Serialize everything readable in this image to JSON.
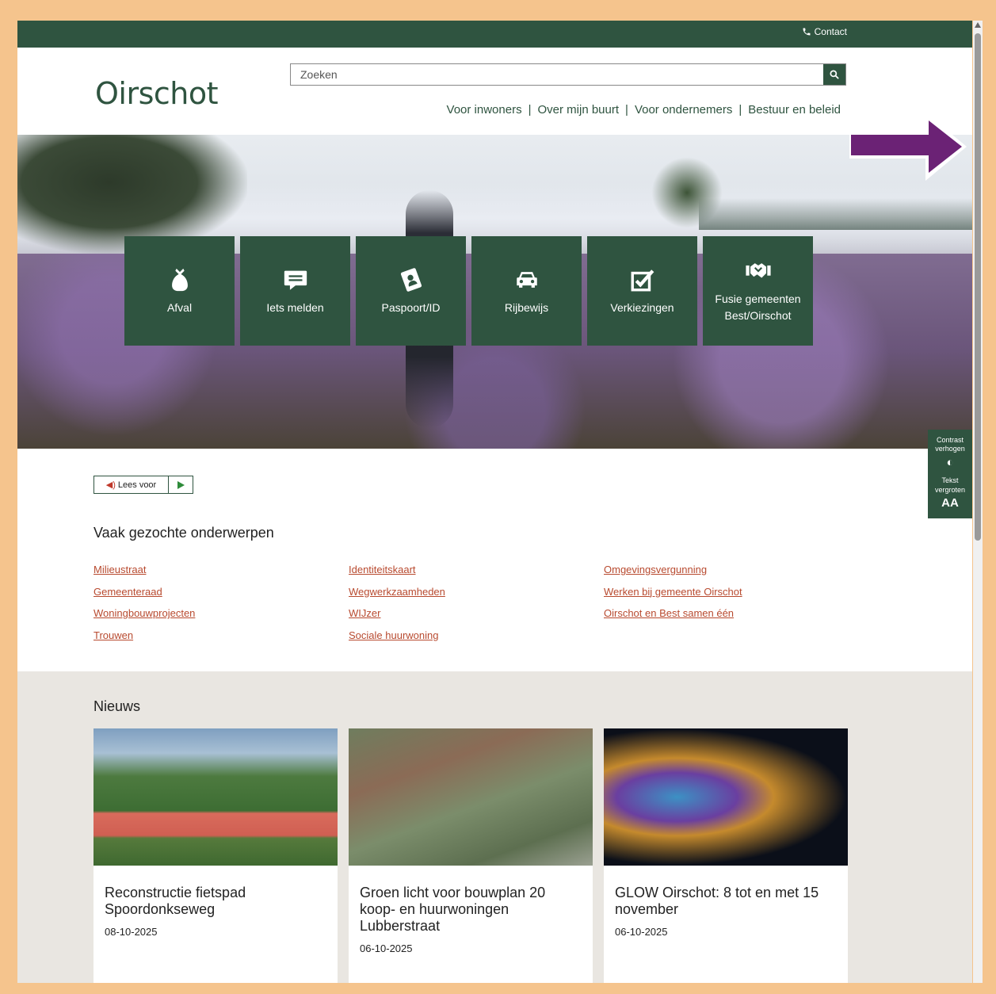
{
  "topbar": {
    "contact_label": "Contact"
  },
  "header": {
    "logo_text": "Oirschot",
    "search_placeholder": "Zoeken",
    "nav": [
      "Voor inwoners",
      "Over mijn buurt",
      "Voor ondernemers",
      "Bestuur en beleid"
    ]
  },
  "tiles": [
    {
      "label": "Afval",
      "icon": "trash-bag-icon"
    },
    {
      "label": "Iets melden",
      "icon": "chat-bubble-icon"
    },
    {
      "label": "Paspoort/ID",
      "icon": "id-card-icon"
    },
    {
      "label": "Rijbewijs",
      "icon": "car-icon"
    },
    {
      "label": "Verkiezingen",
      "icon": "ballot-check-icon"
    },
    {
      "label": "Fusie gemeenten Best/Oirschot",
      "icon": "handshake-icon"
    }
  ],
  "accessibility": {
    "contrast_label": "Contrast verhogen",
    "text_label": "Tekst vergroten",
    "text_glyph": "AA"
  },
  "readspeaker": {
    "label": "Lees voor"
  },
  "popular": {
    "title": "Vaak gezochte onderwerpen",
    "columns": [
      [
        "Milieustraat",
        "Gemeenteraad",
        "Woningbouwprojecten",
        "Trouwen"
      ],
      [
        "Identiteitskaart",
        "Wegwerkzaamheden",
        "WIJzer",
        "Sociale huurwoning"
      ],
      [
        "Omgevingsvergunning",
        "Werken bij gemeente Oirschot",
        "Oirschot en Best samen één"
      ]
    ]
  },
  "news": {
    "title": "Nieuws",
    "items": [
      {
        "title": "Reconstructie fietspad Spoordonkseweg",
        "date": "08-10-2025"
      },
      {
        "title": "Groen licht voor bouwplan 20 koop- en huurwoningen Lubberstraat",
        "date": "06-10-2025"
      },
      {
        "title": "GLOW Oirschot: 8 tot en met 15 november",
        "date": "06-10-2025"
      }
    ]
  },
  "colors": {
    "brand_green": "#2f5440",
    "link_red": "#b84a2f",
    "annotation_arrow": "#6b2275",
    "news_bg": "#e9e6e1"
  }
}
